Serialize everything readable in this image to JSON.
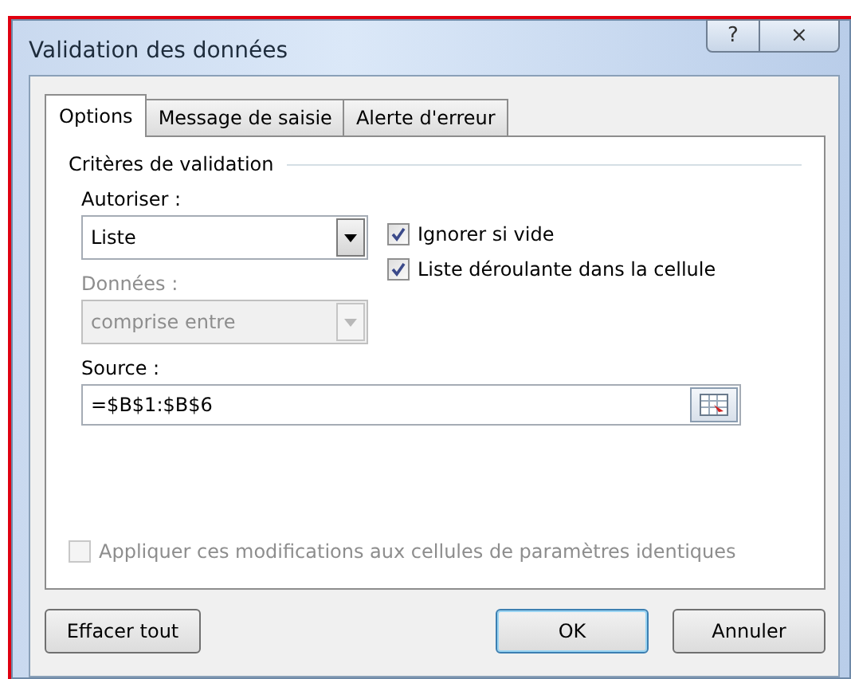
{
  "window": {
    "title": "Validation des données",
    "help_button": "?",
    "close_button": "⨯"
  },
  "tabs": [
    {
      "label": "Options",
      "selected": true
    },
    {
      "label": "Message de saisie",
      "selected": false
    },
    {
      "label": "Alerte d'erreur",
      "selected": false
    }
  ],
  "group": {
    "title": "Critères de validation"
  },
  "allow": {
    "label": "Autoriser :",
    "value": "Liste",
    "disabled": false
  },
  "data": {
    "label": "Données :",
    "value": "comprise entre",
    "disabled": true
  },
  "checkboxes": [
    {
      "label": "Ignorer si vide",
      "checked": true,
      "disabled": false
    },
    {
      "label": "Liste déroulante dans la cellule",
      "checked": true,
      "disabled": false
    }
  ],
  "source": {
    "label": "Source :",
    "value": "=$B$1:$B$6"
  },
  "apply_all": {
    "label": "Appliquer ces modifications aux cellules de paramètres identiques",
    "checked": false,
    "disabled": true
  },
  "buttons": [
    {
      "label": "Effacer tout",
      "default": false
    },
    {
      "label": "OK",
      "default": true
    },
    {
      "label": "Annuler",
      "default": false
    }
  ]
}
